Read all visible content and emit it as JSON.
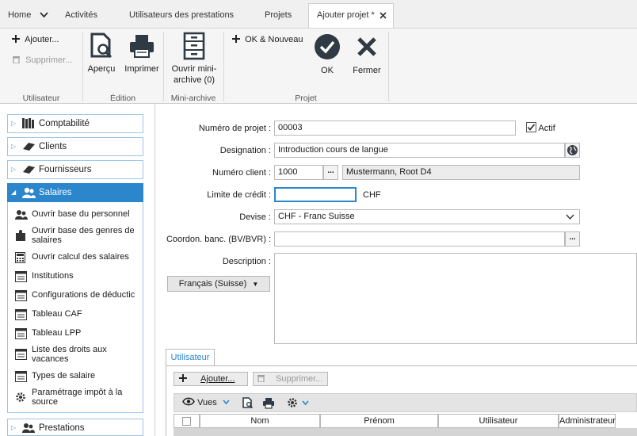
{
  "tabs": {
    "home": "Home",
    "activites": "Activités",
    "utilisateurs": "Utilisateurs des prestations",
    "projets": "Projets",
    "ajouter_projet": "Ajouter projet *"
  },
  "ribbon": {
    "ajouter": "Ajouter...",
    "supprimer": "Supprimer...",
    "group_utilisateur": "Utilisateur",
    "apercu": "Aperçu",
    "imprimer": "Imprimer",
    "group_edition": "Édition",
    "ouvrir_mini_archive_1": "Ouvrir mini-",
    "ouvrir_mini_archive_2": "archive (0)",
    "group_mini_archive": "Mini-archive",
    "ok_nouveau": "OK & Nouveau",
    "ok": "OK",
    "fermer": "Fermer",
    "group_projet": "Projet"
  },
  "sidebar": {
    "comptabilite": "Comptabilité",
    "clients": "Clients",
    "fournisseurs": "Fournisseurs",
    "salaires": "Salaires",
    "prestations": "Prestations",
    "items": [
      "Ouvrir base du personnel",
      "Ouvrir base des genres de salaires",
      "Ouvrir calcul des salaires",
      "Institutions",
      "Configurations de déductic",
      "Tableau CAF",
      "Tableau LPP",
      "Liste des droits aux vacances",
      "Types de salaire",
      "Paramétrage impôt à la source"
    ]
  },
  "form": {
    "numero_projet_label": "Numéro de projet :",
    "numero_projet_value": "00003",
    "actif_label": "Actif",
    "designation_label": "Designation :",
    "designation_value": "Introduction cours de langue",
    "numero_client_label": "Numéro client :",
    "numero_client_value": "1000",
    "client_name": "Mustermann, Root D4",
    "limite_credit_label": "Limite de crédit :",
    "limite_credit_value": "",
    "currency_suffix": "CHF",
    "devise_label": "Devise :",
    "devise_value": "CHF - Franc Suisse",
    "coordon_label": "Coordon. banc. (BV/BVR) :",
    "coordon_value": "",
    "description_label": "Description :",
    "language_button": "Français (Suisse)",
    "dots": "..."
  },
  "bottom": {
    "tab_utilisateur": "Utilisateur",
    "ajouter": "Ajouter...",
    "supprimer": "Supprimer...",
    "vues": "Vues",
    "columns": [
      "Nom",
      "Prénom",
      "Utilisateur",
      "Administrateur"
    ]
  },
  "colors": {
    "accent": "#2b86cc",
    "ok_circle": "#2f3a44"
  }
}
